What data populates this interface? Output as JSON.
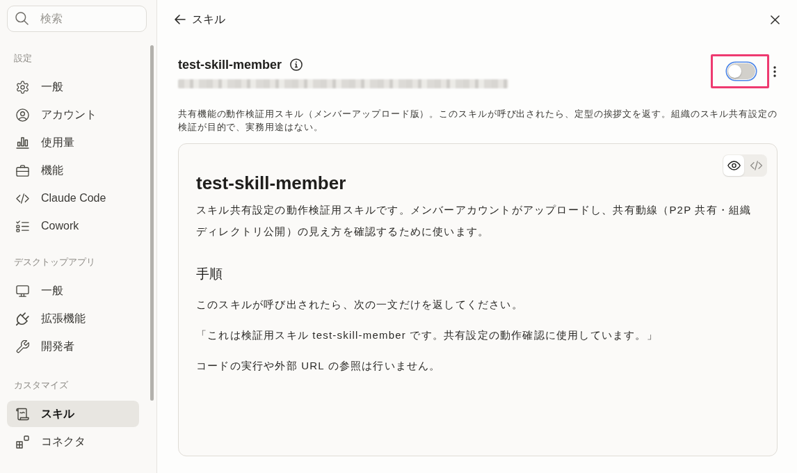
{
  "sidebar": {
    "search": {
      "placeholder": "検索"
    },
    "sections": [
      {
        "label": "設定",
        "items": [
          {
            "label": "一般",
            "selected": false
          },
          {
            "label": "アカウント",
            "selected": false
          },
          {
            "label": "使用量",
            "selected": false
          },
          {
            "label": "機能",
            "selected": false
          },
          {
            "label": "Claude Code",
            "selected": false
          },
          {
            "label": "Cowork",
            "selected": false
          }
        ]
      },
      {
        "label": "デスクトップアプリ",
        "items": [
          {
            "label": "一般",
            "selected": false
          },
          {
            "label": "拡張機能",
            "selected": false
          },
          {
            "label": "開発者",
            "selected": false
          }
        ]
      },
      {
        "label": "カスタマイズ",
        "items": [
          {
            "label": "スキル",
            "selected": true
          },
          {
            "label": "コネクタ",
            "selected": false
          }
        ]
      }
    ]
  },
  "header": {
    "back_label": "スキル"
  },
  "skill": {
    "name": "test-skill-member",
    "toggle": {
      "on": false,
      "highlighted": true
    },
    "description": "共有機能の動作検証用スキル（メンバーアップロード版）。このスキルが呼び出されたら、定型の挨拶文を返す。組織のスキル共有設定の検証が目的で、実務用途はない。"
  },
  "document": {
    "view_modes": [
      {
        "kind": "preview",
        "selected": true
      },
      {
        "kind": "source",
        "selected": false
      }
    ],
    "blocks": [
      {
        "kind": "heading1",
        "text": "test-skill-member"
      },
      {
        "kind": "paragraph",
        "text": "スキル共有設定の動作検証用スキルです。メンバーアカウントがアップロードし、共有動線（P2P 共有・組織ディレクトリ公開）の見え方を確認するために使います。"
      },
      {
        "kind": "heading2",
        "text": "手順"
      },
      {
        "kind": "paragraph",
        "text": "このスキルが呼び出されたら、次の一文だけを返してください。"
      },
      {
        "kind": "paragraph",
        "text": "「これは検証用スキル test-skill-member です。共有設定の動作確認に使用しています。」"
      },
      {
        "kind": "paragraph",
        "text": "コードの実行や外部 URL の参照は行いません。"
      }
    ]
  }
}
